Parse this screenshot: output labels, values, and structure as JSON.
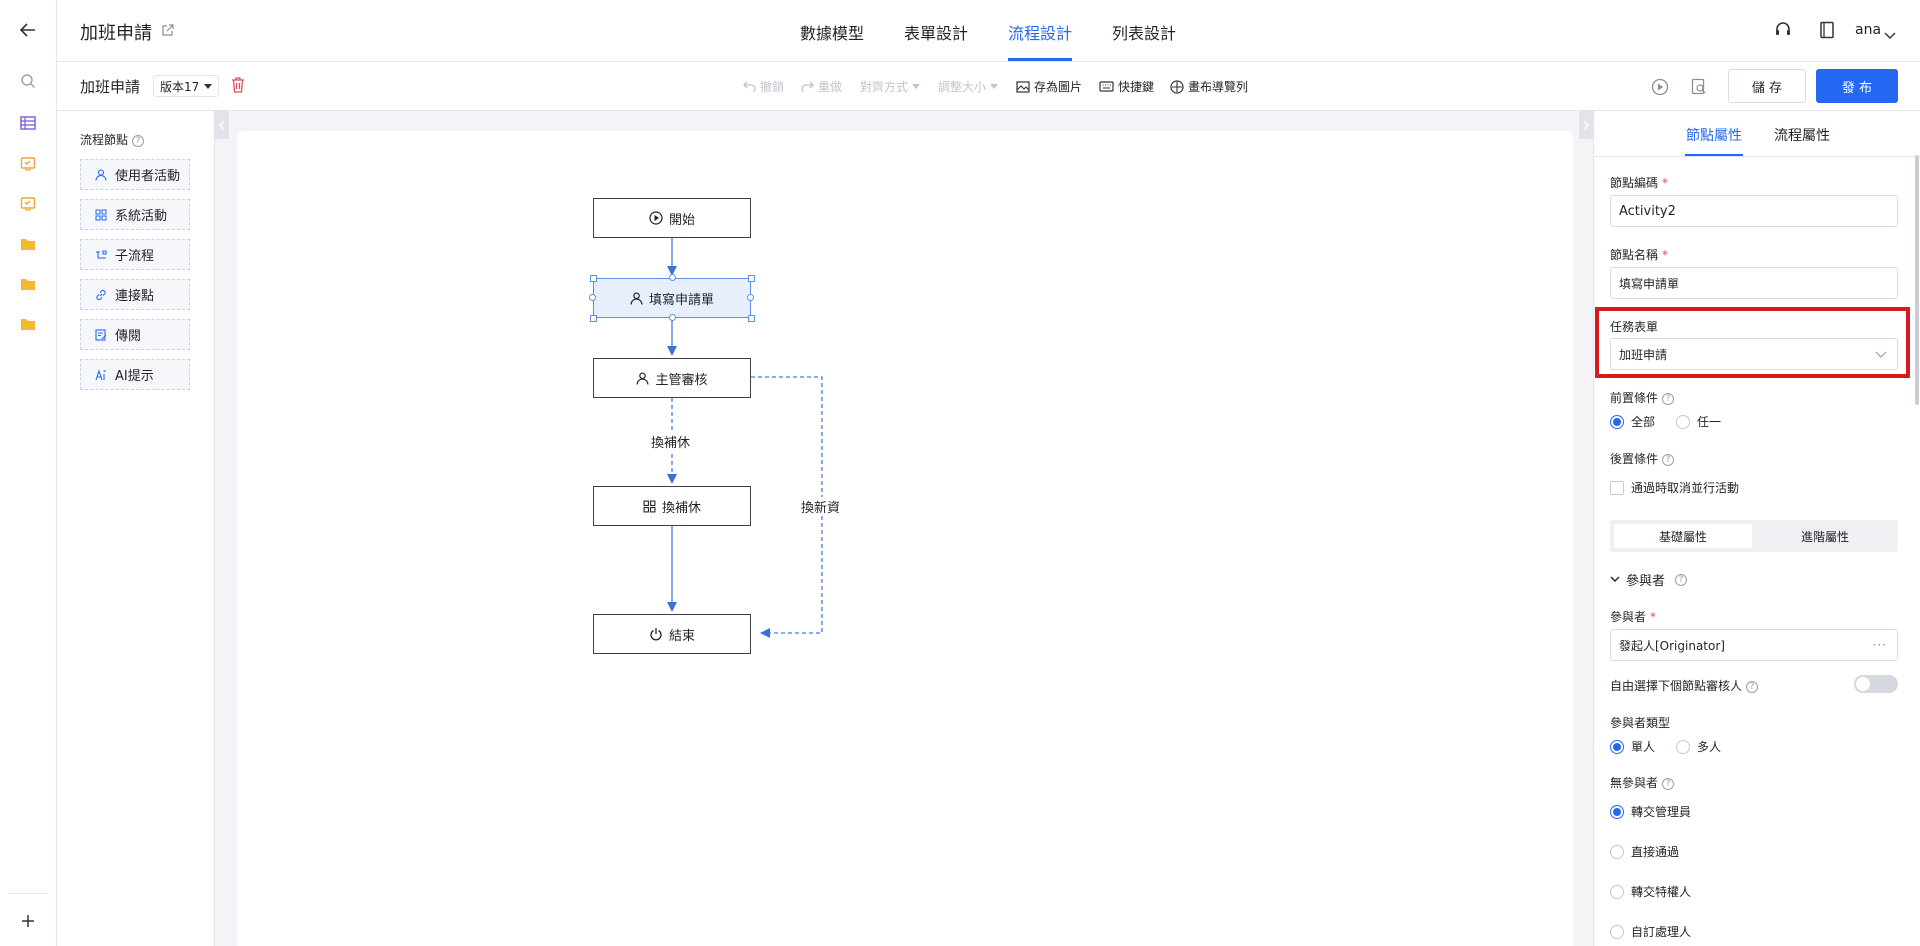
{
  "app": {
    "title": "加班申請"
  },
  "header": {
    "tabs": [
      {
        "label": "數據模型"
      },
      {
        "label": "表單設計"
      },
      {
        "label": "流程設計",
        "active": true
      },
      {
        "label": "列表設計"
      }
    ],
    "user": "ana"
  },
  "toolbar": {
    "flow_name": "加班申請",
    "version": "版本17",
    "undo": "撤銷",
    "redo": "重做",
    "align": "對齊方式",
    "resize": "調整大小",
    "save_image": "存為圖片",
    "shortcuts": "快捷鍵",
    "canvas_nav": "畫布導覽列",
    "save_button": "儲 存",
    "publish_button": "發 布"
  },
  "palette": {
    "title": "流程節點",
    "items": [
      {
        "label": "使用者活動",
        "icon": "user-icon"
      },
      {
        "label": "系統活動",
        "icon": "grid-icon"
      },
      {
        "label": "子流程",
        "icon": "subflow-icon"
      },
      {
        "label": "連接點",
        "icon": "link-icon"
      },
      {
        "label": "傳閱",
        "icon": "circulate-icon"
      },
      {
        "label": "AI提示",
        "icon": "ai-icon"
      }
    ]
  },
  "diagram": {
    "nodes": [
      {
        "id": "start",
        "label": "開始",
        "icon": "play-icon"
      },
      {
        "id": "fill",
        "label": "填寫申請單",
        "icon": "user-icon",
        "selected": true
      },
      {
        "id": "review",
        "label": "主管審核",
        "icon": "user-icon"
      },
      {
        "id": "comp",
        "label": "換補休",
        "icon": "grid-icon"
      },
      {
        "id": "end",
        "label": "結束",
        "icon": "power-icon"
      }
    ],
    "edge_labels": {
      "comp_leave": "換補休",
      "comp_pay": "換新資"
    }
  },
  "panel": {
    "tabs": [
      {
        "label": "節點屬性",
        "active": true
      },
      {
        "label": "流程屬性"
      }
    ],
    "node_code_label": "節點編碼",
    "node_code_value": "Activity2",
    "node_name_label": "節點名稱",
    "node_name_value": "填寫申請單",
    "task_form_label": "任務表單",
    "task_form_value": "加班申請",
    "pre_condition_label": "前置條件",
    "pre_condition_options": [
      {
        "label": "全部",
        "checked": true
      },
      {
        "label": "任一"
      }
    ],
    "post_condition_label": "後置條件",
    "post_condition_checkbox": "通過時取消並行活動",
    "subtabs": [
      {
        "label": "基礎屬性",
        "active": true
      },
      {
        "label": "進階屬性"
      }
    ],
    "participants_section": "參與者",
    "participant_label": "參與者",
    "participant_value": "發起人[Originator]",
    "free_select_label": "自由選擇下個節點審核人",
    "participant_type_label": "參與者類型",
    "participant_type_options": [
      {
        "label": "單人",
        "checked": true
      },
      {
        "label": "多人"
      }
    ],
    "no_participant_label": "無參與者",
    "no_participant_options": [
      {
        "label": "轉交管理員",
        "checked": true
      },
      {
        "label": "直接通過"
      },
      {
        "label": "轉交特權人"
      },
      {
        "label": "自訂處理人"
      }
    ]
  },
  "colors": {
    "accent": "#2468f2",
    "highlight": "#d61a1f"
  }
}
